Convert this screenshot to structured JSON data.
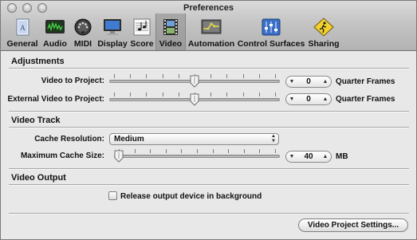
{
  "window": {
    "title": "Preferences"
  },
  "toolbar": {
    "items": [
      {
        "label": "General",
        "icon": "general-icon"
      },
      {
        "label": "Audio",
        "icon": "audio-icon"
      },
      {
        "label": "MIDI",
        "icon": "midi-icon"
      },
      {
        "label": "Display",
        "icon": "display-icon"
      },
      {
        "label": "Score",
        "icon": "score-icon"
      },
      {
        "label": "Video",
        "icon": "video-icon",
        "selected": true
      },
      {
        "label": "Automation",
        "icon": "automation-icon"
      },
      {
        "label": "Control Surfaces",
        "icon": "control-surfaces-icon"
      },
      {
        "label": "Sharing",
        "icon": "sharing-icon"
      }
    ]
  },
  "adjustments": {
    "title": "Adjustments",
    "video_to_project": {
      "label": "Video to Project:",
      "value": "0",
      "unit": "Quarter Frames",
      "slider_fraction": 0.5
    },
    "external_video_to_project": {
      "label": "External Video to Project:",
      "value": "0",
      "unit": "Quarter Frames",
      "slider_fraction": 0.5
    }
  },
  "video_track": {
    "title": "Video Track",
    "cache_resolution": {
      "label": "Cache Resolution:",
      "value": "Medium"
    },
    "max_cache_size": {
      "label": "Maximum Cache Size:",
      "value": "40",
      "unit": "MB",
      "slider_fraction": 0.0
    }
  },
  "video_output": {
    "title": "Video Output",
    "release_checkbox": {
      "label": "Release output device in background",
      "checked": false
    }
  },
  "footer": {
    "project_settings_button": "Video Project Settings..."
  }
}
